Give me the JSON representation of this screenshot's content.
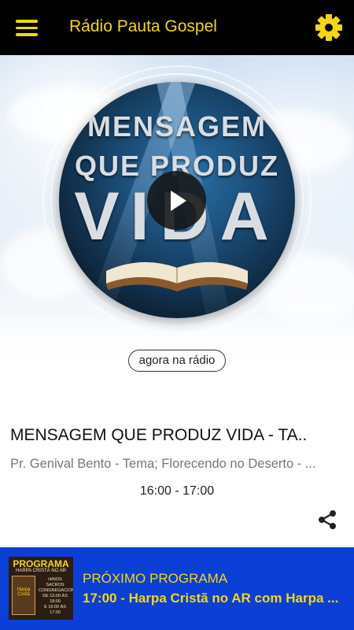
{
  "header": {
    "title": "Rádio Pauta Gospel",
    "menu_icon": "hamburger-menu-icon",
    "settings_icon": "gear-icon",
    "accent_color": "#f5d60f",
    "background_color": "#000000"
  },
  "player": {
    "cover_text": [
      "MENSAGEM",
      "QUE PRODUZ",
      "VIDA"
    ],
    "play_icon": "play-icon",
    "now_badge": "agora na rádio"
  },
  "now_playing": {
    "title": "MENSAGEM QUE PRODUZ VIDA - TA..",
    "subtitle": "Pr. Genival Bento - Tema; Florecendo no Deserto - ...",
    "time": "16:00 - 17:00",
    "share_icon": "share-icon"
  },
  "next_program": {
    "label": "PRÓXIMO PROGRAMA",
    "title": "17:00 - Harpa Cristã no AR com Harpa ...",
    "background_color": "#0c3fd6",
    "thumbnail": {
      "heading": "PROGRAMA",
      "subheading": "HARPA CRISTÃ NO AR",
      "book_text": "Harpa Cristã",
      "lines": [
        "HINOS SACROS",
        "CONGREGACIONAIS",
        "DE 15:00 ÀS 18:00",
        "E 16:00 ÀS 17:00"
      ]
    }
  }
}
